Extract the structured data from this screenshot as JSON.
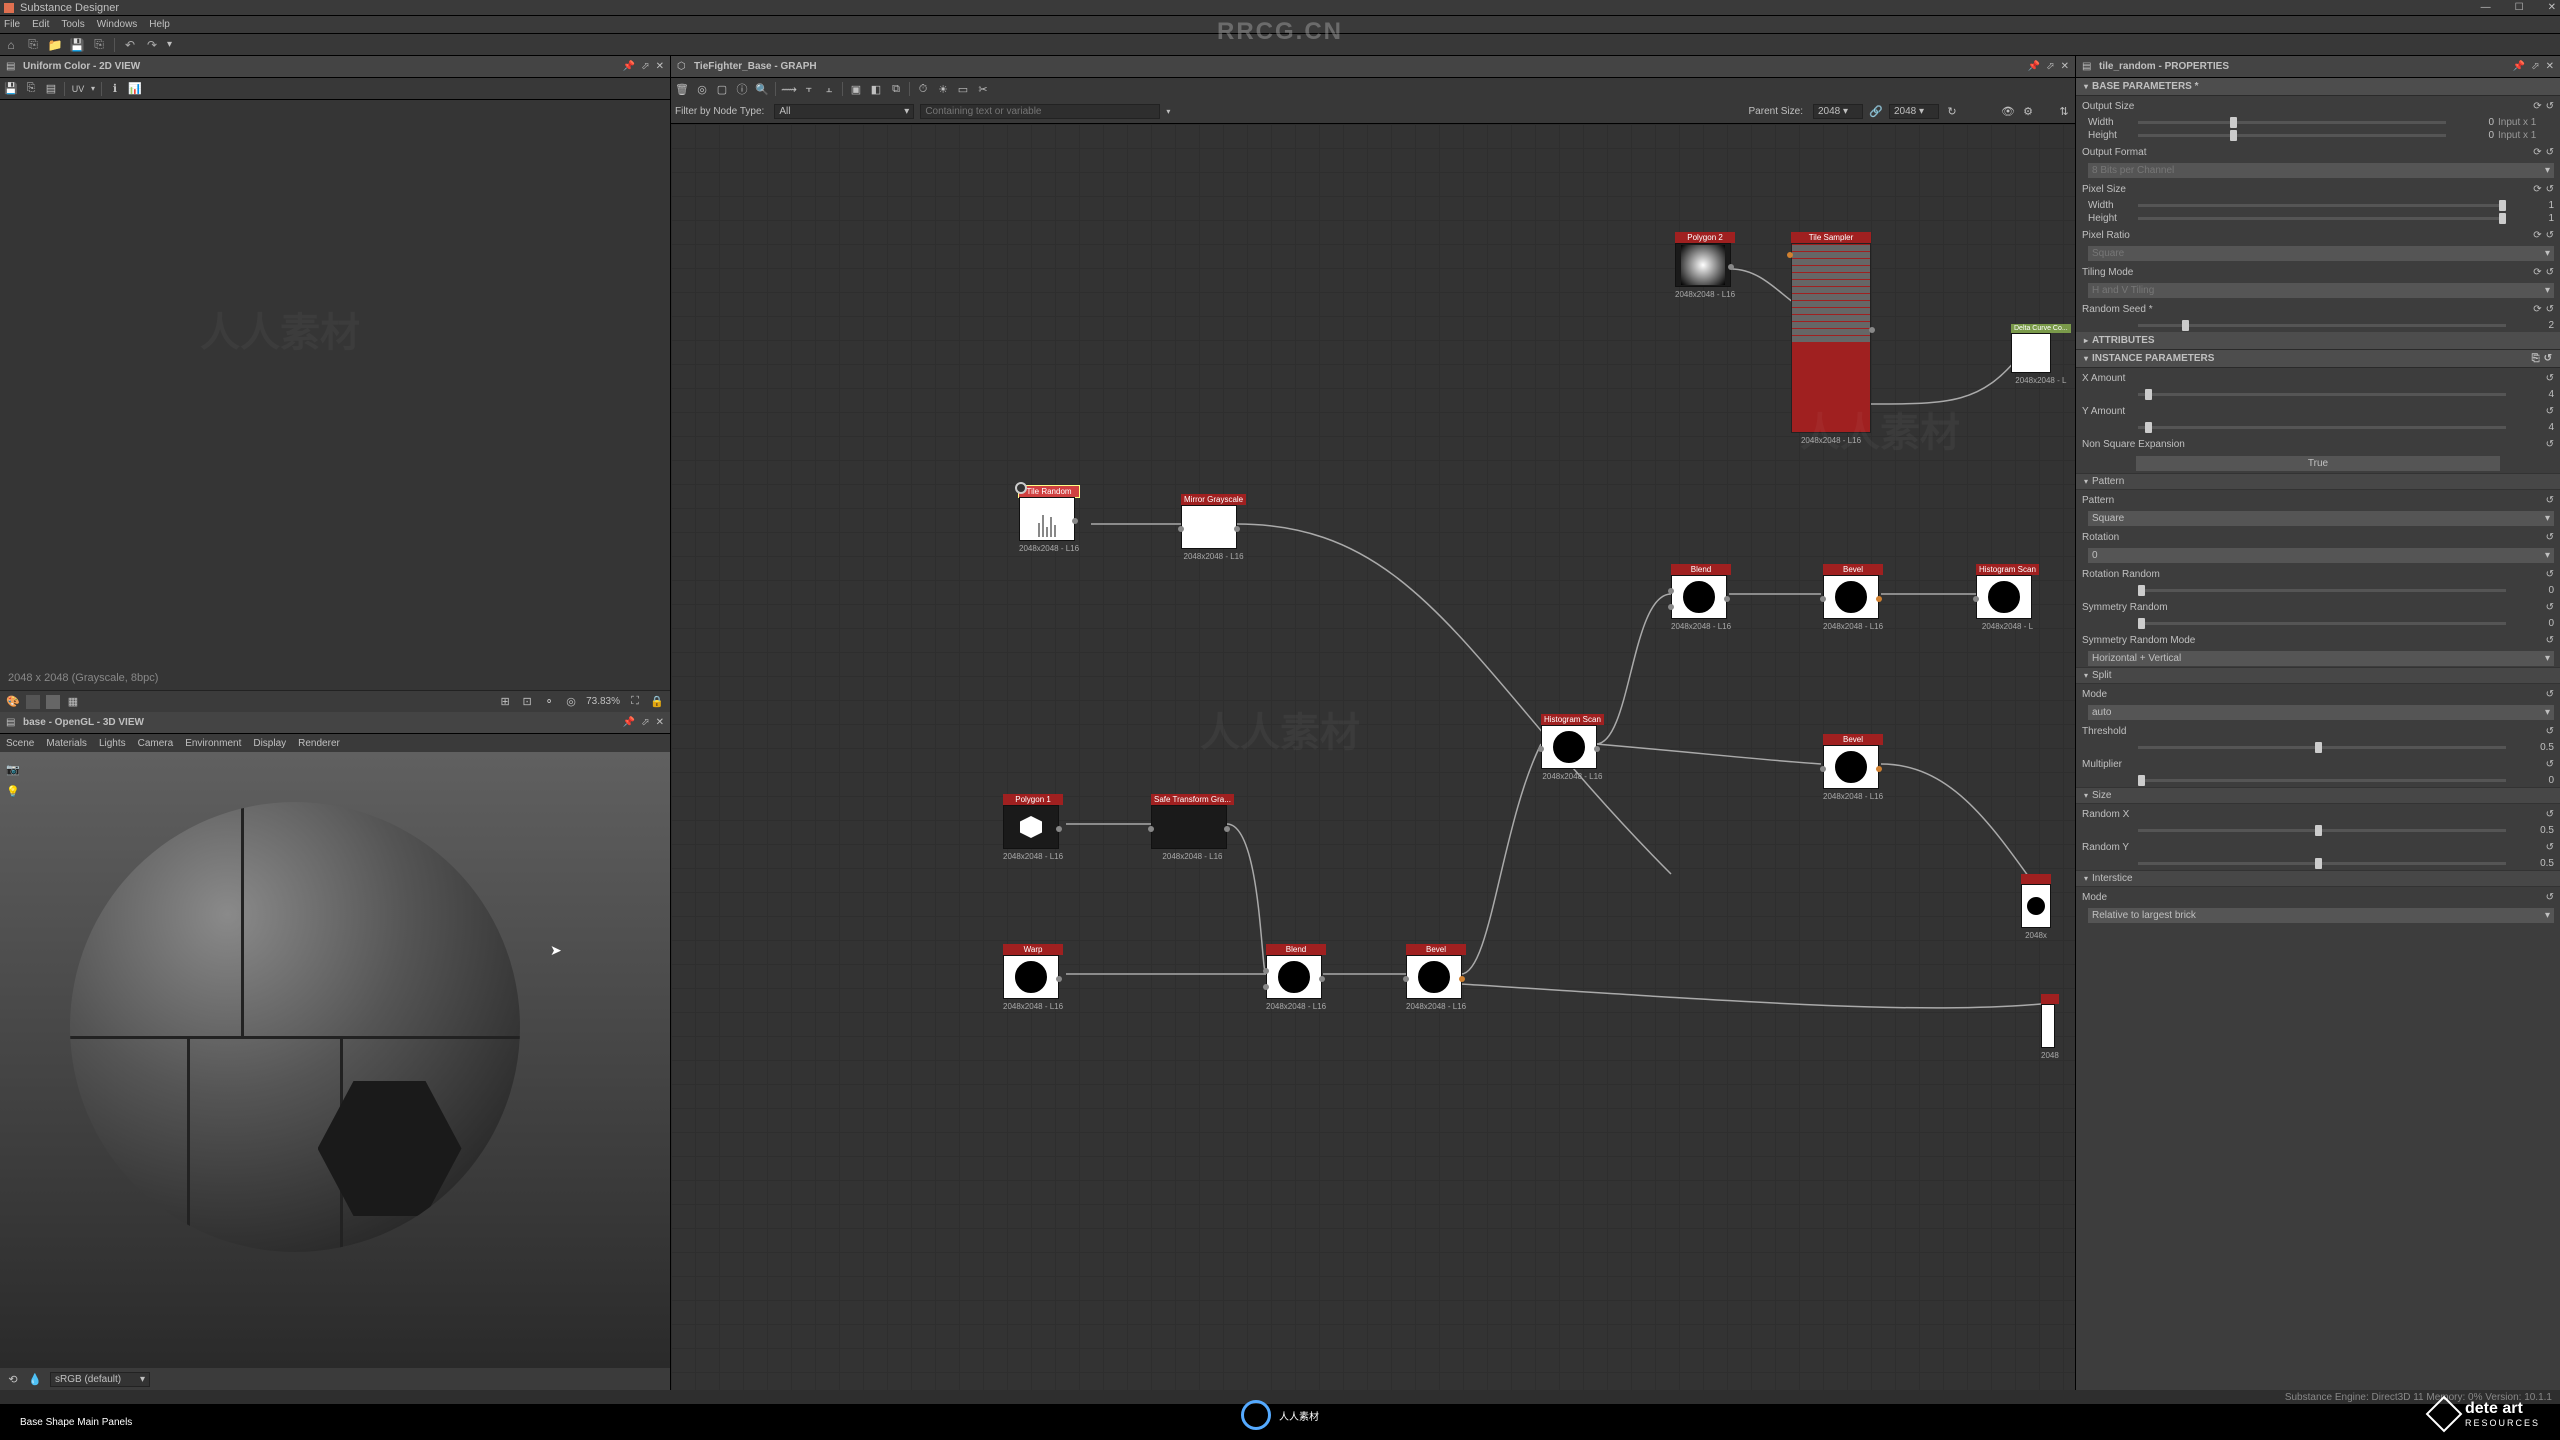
{
  "app": {
    "title": "Substance Designer"
  },
  "menu": {
    "file": "File",
    "edit": "Edit",
    "tools": "Tools",
    "windows": "Windows",
    "help": "Help"
  },
  "panel2d": {
    "title": "Uniform Color - 2D VIEW",
    "uv_label": "UV",
    "status": "2048 x 2048 (Grayscale, 8bpc)",
    "footer_zoom": "73.83%"
  },
  "panel3d": {
    "title": "base - OpenGL - 3D VIEW",
    "menu": {
      "scene": "Scene",
      "materials": "Materials",
      "lights": "Lights",
      "camera": "Camera",
      "environment": "Environment",
      "display": "Display",
      "renderer": "Renderer"
    },
    "colorspace": "sRGB (default)"
  },
  "graph": {
    "title": "TieFighter_Base - GRAPH",
    "filter_label": "Filter by Node Type:",
    "filter_value": "All",
    "search_placeholder": "Containing text or variable",
    "parent_label": "Parent Size:",
    "parent_w": "2048",
    "parent_h": "2048",
    "node_caption": "2048x2048 - L16",
    "node_caption_cut": "2048x2048 - L",
    "node_caption_cut2": "2048x",
    "node_caption_cut3": "2048",
    "nodes": {
      "tile_random": "Tile Random",
      "mirror_grayscale": "Mirror Grayscale",
      "polygon1": "Polygon 1",
      "safe_transform": "Safe Transform Gra...",
      "warp": "Warp",
      "blend": "Blend",
      "bevel": "Bevel",
      "histogram_scan": "Histogram Scan",
      "polygon2": "Polygon 2",
      "tile_sampler": "Tile Sampler",
      "delta_curve": "Delta Curve Co..."
    }
  },
  "props": {
    "title": "tile_random - PROPERTIES",
    "sec_base": "BASE PARAMETERS *",
    "output_size": "Output Size",
    "width": "Width",
    "height": "Height",
    "val_0": "0",
    "input_x1": "Input x 1",
    "output_format": "Output Format",
    "output_format_val": "8 Bits per Channel",
    "pixel_size": "Pixel Size",
    "val_1": "1",
    "pixel_ratio": "Pixel Ratio",
    "pixel_ratio_val": "Square",
    "tiling_mode": "Tiling Mode",
    "tiling_mode_val": "H and V Tiling",
    "random_seed": "Random Seed *",
    "val_2": "2",
    "sec_attributes": "ATTRIBUTES",
    "sec_instance": "INSTANCE PARAMETERS",
    "x_amount": "X Amount",
    "val_4": "4",
    "y_amount": "Y Amount",
    "non_square": "Non Square Expansion",
    "true": "True",
    "sub_pattern": "Pattern",
    "pattern": "Pattern",
    "pattern_val": "Square",
    "rotation": "Rotation",
    "rotation_random": "Rotation Random",
    "symmetry_random": "Symmetry Random",
    "symmetry_mode": "Symmetry Random Mode",
    "symmetry_mode_val": "Horizontal + Vertical",
    "sub_split": "Split",
    "mode": "Mode",
    "mode_val": "auto",
    "threshold": "Threshold",
    "val_05": "0.5",
    "multiplier": "Multiplier",
    "sub_size": "Size",
    "random_x": "Random X",
    "random_y": "Random Y",
    "sub_interstice": "Interstice",
    "interstice_mode_val": "Relative to largest brick"
  },
  "statusbar": {
    "text": "Substance Engine: Direct3D 11  Memory: 0%     Version: 10.1.1"
  },
  "caption": {
    "text": "Base Shape Main Panels",
    "brand_center": "人人素材",
    "brand_top": "RRCG.CN",
    "brand_right": "dete art",
    "brand_right_sub": "RESOURCES"
  }
}
